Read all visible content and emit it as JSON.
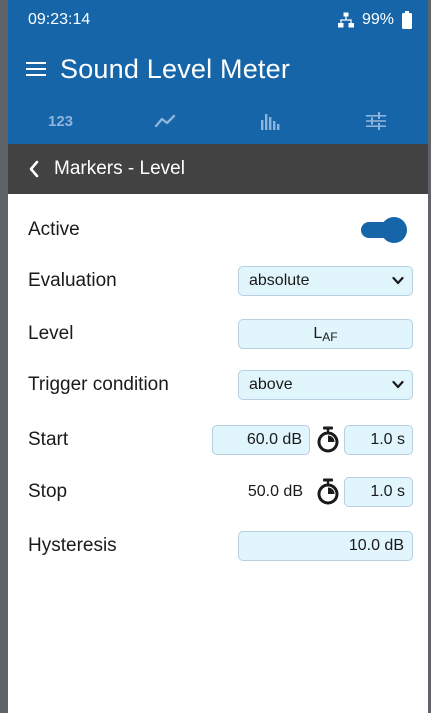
{
  "status_bar": {
    "time": "09:23:14",
    "battery": "99%",
    "network_icon": "network-icon",
    "battery_icon": "battery-icon"
  },
  "app_bar": {
    "title": "Sound Level Meter",
    "menu_icon": "hamburger-menu-icon"
  },
  "tabs": [
    {
      "label": "123",
      "name": "numeric"
    },
    {
      "icon": "line-chart-icon",
      "name": "trend"
    },
    {
      "icon": "spectrum-bars-icon",
      "name": "spectrum"
    },
    {
      "icon": "sliders-icon",
      "name": "settings"
    }
  ],
  "subheader": {
    "title": "Markers - Level",
    "back_icon": "back-chevron-icon"
  },
  "form": {
    "active": {
      "label": "Active",
      "value": true
    },
    "evaluation": {
      "label": "Evaluation",
      "value": "absolute"
    },
    "level": {
      "label": "Level",
      "value_main": "L",
      "value_sub": "AF"
    },
    "trigger": {
      "label": "Trigger condition",
      "value": "above"
    },
    "start": {
      "label": "Start",
      "level": "60.0 dB",
      "duration": "1.0 s"
    },
    "stop": {
      "label": "Stop",
      "level": "50.0 dB",
      "duration": "1.0 s"
    },
    "hysteresis": {
      "label": "Hysteresis",
      "value": "10.0 dB"
    }
  },
  "colors": {
    "primary": "#1565a8",
    "subheader": "#424242",
    "field_bg": "#e1f5fd",
    "tab_icon": "#8fb4d9"
  }
}
